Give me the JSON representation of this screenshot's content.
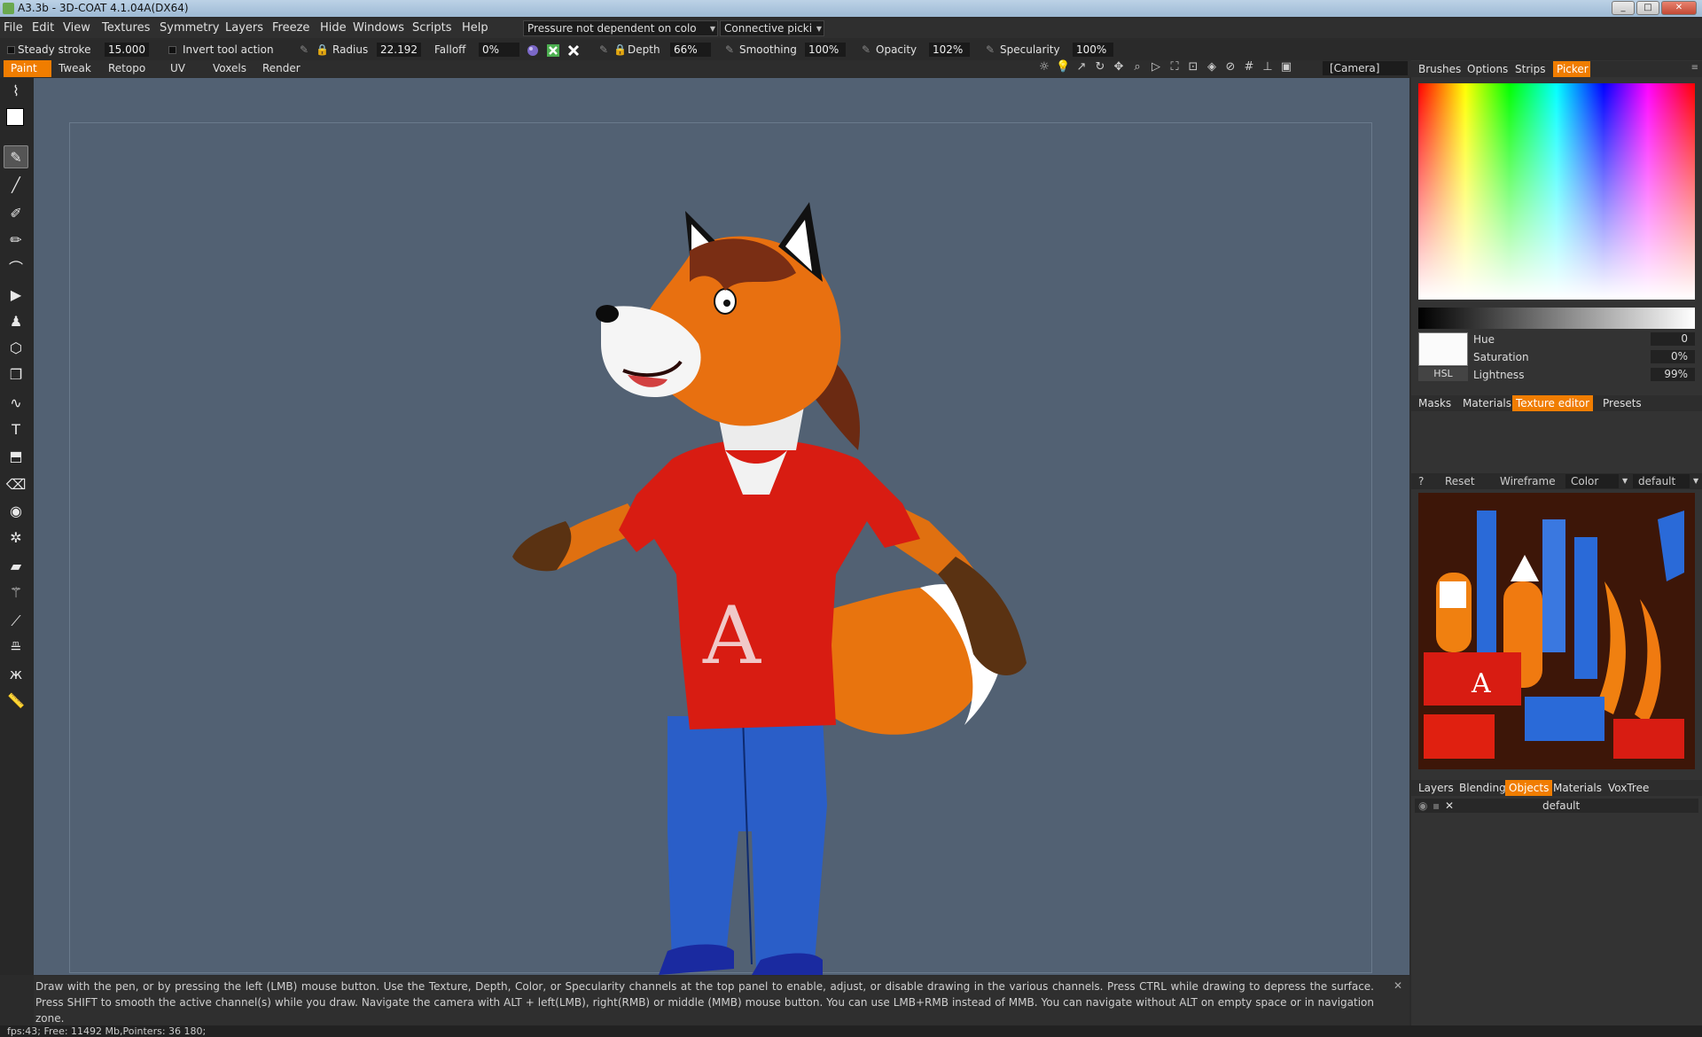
{
  "window": {
    "title": "A3.3b - 3D-COAT 4.1.04A(DX64)"
  },
  "menu": [
    "File",
    "Edit",
    "View",
    "Textures",
    "Symmetry",
    "Layers",
    "Freeze",
    "Hide",
    "Windows",
    "Scripts",
    "Help"
  ],
  "menu_dropdowns": {
    "pressure": "Pressure not dependent on colo",
    "picking": "Connective picki"
  },
  "toolbar": {
    "steady_label": "Steady stroke",
    "steady_value": "15.000",
    "invert_label": "Invert tool action",
    "radius_label": "Radius",
    "radius_value": "22.192",
    "falloff_label": "Falloff",
    "falloff_value": "0%",
    "depth_label": "Depth",
    "depth_value": "66%",
    "smoothing_label": "Smoothing",
    "smoothing_value": "100%",
    "opacity_label": "Opacity",
    "opacity_value": "102%",
    "specularity_label": "Specularity",
    "specularity_value": "100%"
  },
  "modes": [
    "Paint",
    "Tweak",
    "Retopo",
    "UV",
    "Voxels",
    "Render"
  ],
  "active_mode": "Paint",
  "camera_dropdown": "[Camera]",
  "right_tabs_top": [
    "Brushes",
    "Options",
    "Strips",
    "Picker"
  ],
  "active_right_tab": "Picker",
  "picker": {
    "mode": "HSL",
    "hue_label": "Hue",
    "hue": "0",
    "sat_label": "Saturation",
    "sat": "0%",
    "light_label": "Lightness",
    "light": "99%"
  },
  "mid_tabs": [
    "Masks",
    "Materials",
    "Texture editor",
    "Presets"
  ],
  "active_mid_tab": "Texture editor",
  "texture_editor": {
    "help": "?",
    "reset": "Reset",
    "wireframe": "Wireframe",
    "channel": "Color",
    "uvset": "default"
  },
  "bottom_tabs": [
    "Layers",
    "Blending",
    "Objects",
    "Materials",
    "VoxTree"
  ],
  "active_bottom_tab": "Objects",
  "objects": [
    {
      "name": "default"
    }
  ],
  "hint": "Draw with the pen, or by pressing the left (LMB) mouse button. Use the Texture, Depth, Color, or Specularity channels at the top panel to enable, adjust, or disable drawing in the various channels. Press CTRL while drawing to depress the surface. Press SHIFT to smooth the active channel(s) while you draw. Navigate the camera with ALT + left(LMB), right(RMB)  or middle (MMB) mouse button. You can use LMB+RMB instead of MMB. You can navigate without ALT on empty space or in navigation zone.",
  "status": "fps:43;    Free: 11492 Mb,Pointers: 36 180;",
  "model_shirt_letter": "A",
  "colors": {
    "accent": "#f07d00",
    "viewport": "#526173",
    "shirt": "#d81c12",
    "jeans": "#2a5ec8",
    "fur": "#f07a10"
  }
}
